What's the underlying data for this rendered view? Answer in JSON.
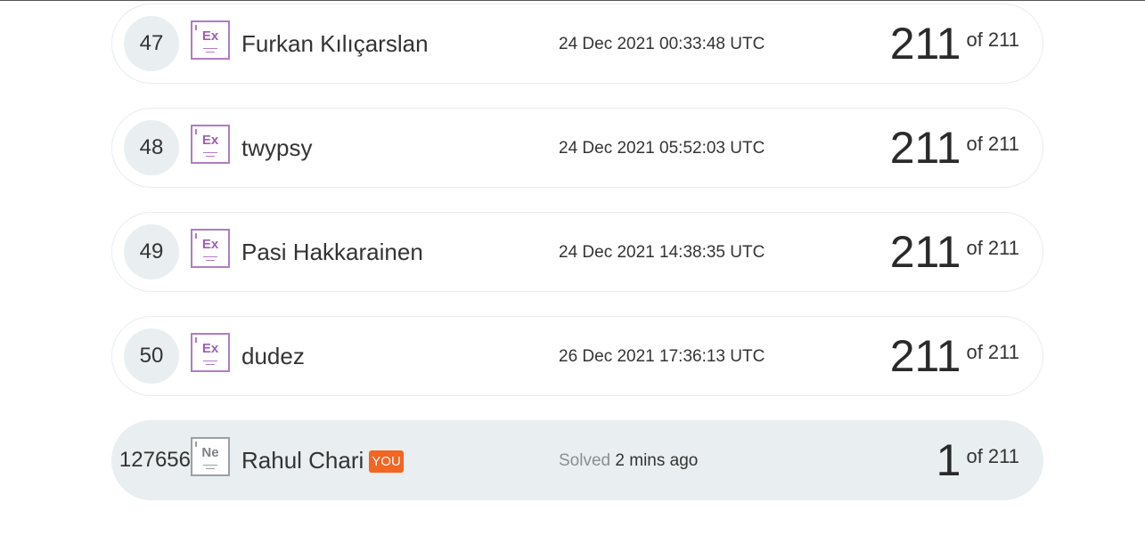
{
  "leaderboard": {
    "rows": [
      {
        "rank": "47",
        "level_symbol": "Ex",
        "name": "Furkan Kılıçarslan",
        "date": "24 Dec 2021 00:33:48 UTC",
        "score": "211",
        "of_label": "of 211"
      },
      {
        "rank": "48",
        "level_symbol": "Ex",
        "name": "twypsy",
        "date": "24 Dec 2021 05:52:03 UTC",
        "score": "211",
        "of_label": "of 211"
      },
      {
        "rank": "49",
        "level_symbol": "Ex",
        "name": "Pasi Hakkarainen",
        "date": "24 Dec 2021 14:38:35 UTC",
        "score": "211",
        "of_label": "of 211"
      },
      {
        "rank": "50",
        "level_symbol": "Ex",
        "name": "dudez",
        "date": "26 Dec 2021 17:36:13 UTC",
        "score": "211",
        "of_label": "of 211"
      }
    ],
    "current_user": {
      "rank": "127656",
      "level_symbol": "Ne",
      "name": "Rahul Chari",
      "badge": "YOU",
      "solved_label": "Solved",
      "solved_ago": "2 mins ago",
      "score": "1",
      "of_label": "of 211"
    }
  },
  "colors": {
    "expert_level": "#b07cc6",
    "newbie_level": "#9aa0a4",
    "you_badge": "#f26522",
    "row_highlight": "#e9eef0"
  },
  "icons": {
    "level_icon": "periodic-element-icon"
  }
}
